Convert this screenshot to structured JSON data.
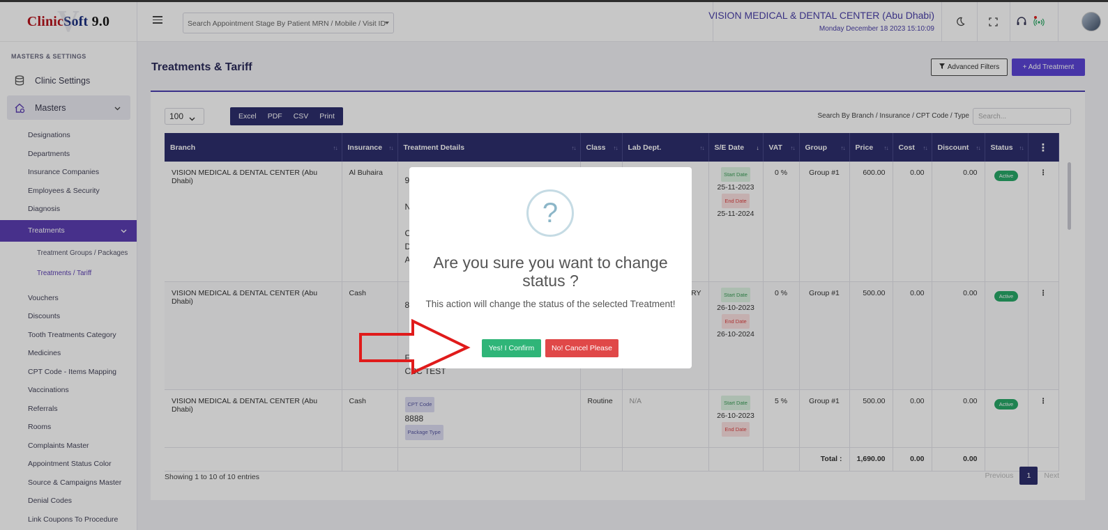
{
  "app": {
    "logo_part1": "Clinic",
    "logo_part2": "Soft",
    "logo_version": " 9.0",
    "logo_watermark": "V"
  },
  "header": {
    "search_placeholder": "Search Appointment Stage By Patient MRN / Mobile / Visit ID",
    "clinic_name": "VISION MEDICAL & DENTAL CENTER (Abu Dhabi)",
    "datetime": "Monday December 18 2023 15:10:09",
    "icons": [
      "moon-icon",
      "fullscreen-icon",
      "headset-icon",
      "broadcast-icon"
    ]
  },
  "sidebar": {
    "heading": "MASTERS & SETTINGS",
    "clinic_settings": "Clinic Settings",
    "masters": "Masters",
    "items_before": [
      "Designations",
      "Departments",
      "Insurance Companies",
      "Employees & Security",
      "Diagnosis"
    ],
    "treatments": "Treatments",
    "treatments_children": [
      "Treatment Groups / Packages",
      "Treatments / Tariff"
    ],
    "items_after": [
      "Vouchers",
      "Discounts",
      "Tooth Treatments Category",
      "Medicines",
      "CPT Code - Items Mapping",
      "Vaccinations",
      "Referrals",
      "Rooms",
      "Complaints Master",
      "Appointment Status Color",
      "Source & Campaigns Master",
      "Denial Codes",
      "Link Coupons To Procedure"
    ]
  },
  "page": {
    "title": "Treatments & Tariff",
    "advanced_filters": "Advanced Filters",
    "add_treatment": "+ Add Treatment",
    "page_length": "100",
    "export_buttons": [
      "Excel",
      "PDF",
      "CSV",
      "Print"
    ],
    "search_label": "Search By Branch / Insurance / CPT Code / Type",
    "search_placeholder": "Search..."
  },
  "table": {
    "columns": [
      "Branch",
      "Insurance",
      "Treatment Details",
      "Class",
      "Lab Dept.",
      "S/E Date",
      "VAT",
      "Group",
      "Price",
      "Cost",
      "Discount",
      "Status",
      "⋮"
    ],
    "rows": [
      {
        "branch": "VISION MEDICAL & DENTAL CENTER (Abu Dhabi)",
        "insurance": "Al Buhaira",
        "details": [
          "9",
          "N",
          "C",
          "D",
          "A"
        ],
        "class": "",
        "lab": "",
        "start_label": "Start Date",
        "start": "25-11-2023",
        "end_label": "End Date",
        "end": "25-11-2024",
        "vat": "0 %",
        "group": "Group #1",
        "price": "600.00",
        "cost": "0.00",
        "discount": "0.00",
        "status": "Active"
      },
      {
        "branch": "VISION MEDICAL & DENTAL CENTER (Abu Dhabi)",
        "insurance": "Cash",
        "details": [
          "8",
          "F",
          "CBC TEST"
        ],
        "class": "",
        "lab": "STRY",
        "start_label": "Start Date",
        "start": "26-10-2023",
        "end_label": "End Date",
        "end": "26-10-2024",
        "vat": "0 %",
        "group": "Group #1",
        "price": "500.00",
        "cost": "0.00",
        "discount": "0.00",
        "status": "Active"
      },
      {
        "branch": "VISION MEDICAL & DENTAL CENTER (Abu Dhabi)",
        "insurance": "Cash",
        "cpt_label": "CPT Code",
        "cpt": "8888",
        "pkg_label": "Package Type",
        "class": "Routine",
        "lab": "N/A",
        "start_label": "Start Date",
        "start": "26-10-2023",
        "end_label": "End Date",
        "end": "26-10-2024",
        "vat": "5 %",
        "group": "Group #1",
        "price": "500.00",
        "cost": "0.00",
        "discount": "0.00",
        "status": "Active"
      }
    ],
    "totals": {
      "label": "Total :",
      "price": "1,690.00",
      "cost": "0.00",
      "discount": "0.00"
    }
  },
  "footer": {
    "showing": "Showing 1 to 10 of 10 entries",
    "previous": "Previous",
    "page": "1",
    "next": "Next"
  },
  "modal": {
    "icon": "?",
    "title": "Are you sure you want to change status ?",
    "text": "This action will change the status of the selected Treatment!",
    "confirm": "Yes! I Confirm",
    "cancel": "No! Cancel Please"
  },
  "colors": {
    "primary": "#2e2f6e",
    "accent": "#5b3eb3",
    "confirm": "#2fb578",
    "cancel": "#e04848",
    "annotation_arrow": "#e01b1b"
  }
}
